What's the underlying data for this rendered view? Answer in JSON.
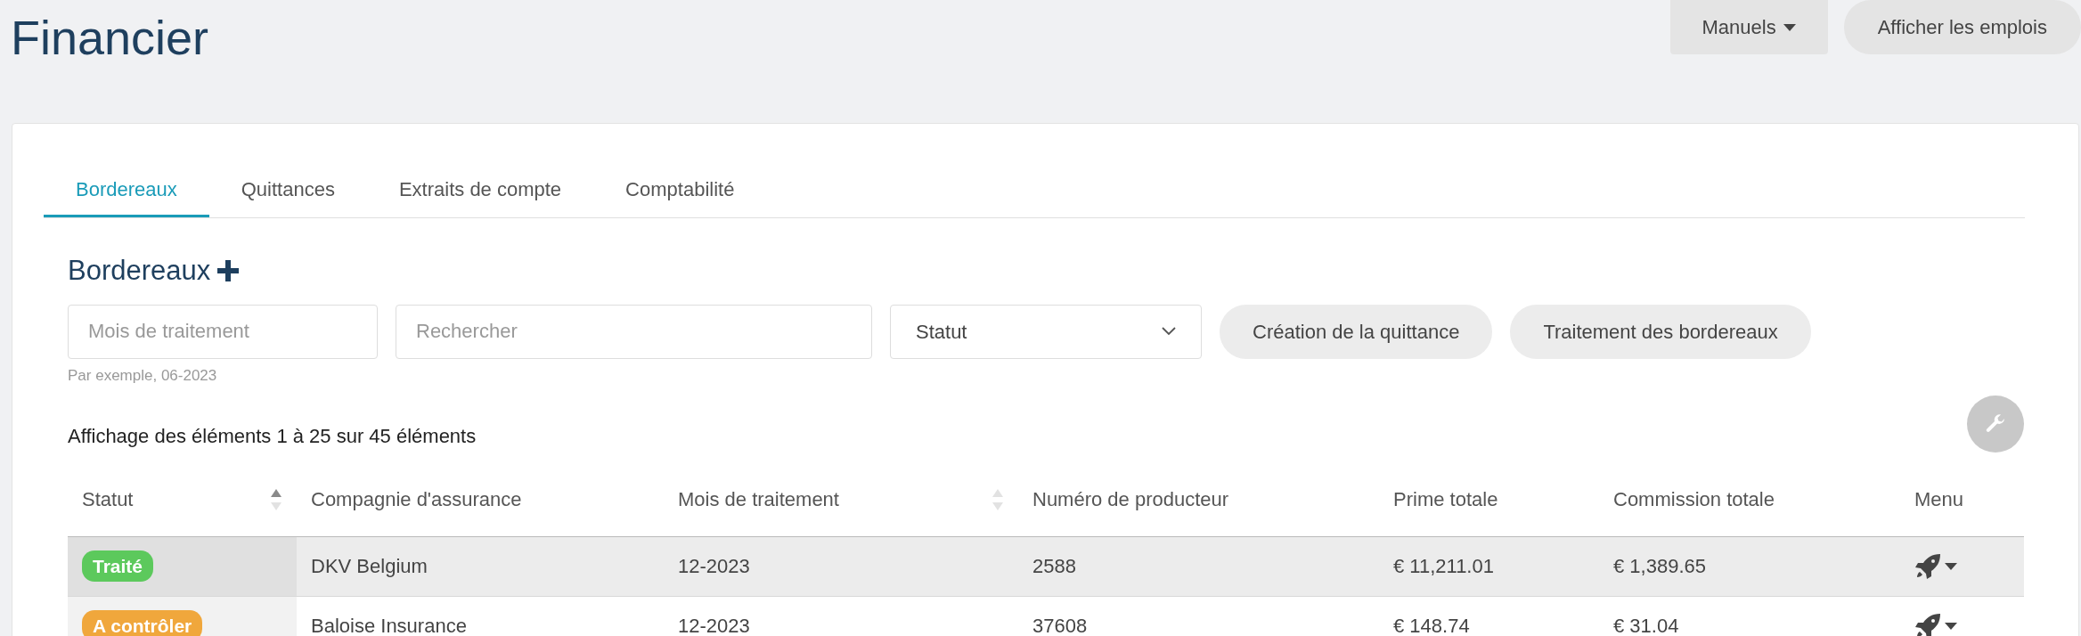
{
  "page_title": "Financier",
  "header_buttons": [
    {
      "label": "Manuels",
      "kind": "dropdown"
    },
    {
      "label": "Afficher les emplois",
      "kind": "pill"
    }
  ],
  "tabs": [
    {
      "label": "Bordereaux",
      "selected": true
    },
    {
      "label": "Quittances",
      "selected": false
    },
    {
      "label": "Extraits de compte",
      "selected": false
    },
    {
      "label": "Comptabilité",
      "selected": false
    }
  ],
  "section_title": "Bordereaux",
  "filters": {
    "month": {
      "placeholder": "Mois de traitement",
      "hint": "Par exemple, 06-2023"
    },
    "search": {
      "placeholder": "Rechercher"
    },
    "status": {
      "value": "Statut"
    }
  },
  "actions": [
    "Création de la quittance",
    "Traitement des bordereaux"
  ],
  "info": "Affichage des éléments 1 à 25 sur 45 éléments",
  "table": {
    "columns": [
      {
        "label": "Statut",
        "sortable": true,
        "sorted": true
      },
      {
        "label": "Compagnie d'assurance",
        "sortable": false,
        "sorted": false
      },
      {
        "label": "Mois de traitement",
        "sortable": true,
        "sorted": false
      },
      {
        "label": "Numéro de producteur",
        "sortable": false,
        "sorted": false
      },
      {
        "label": "Prime totale",
        "sortable": false,
        "sorted": false
      },
      {
        "label": "Commission totale",
        "sortable": false,
        "sorted": false
      },
      {
        "label": "Menu",
        "sortable": false,
        "sorted": false
      }
    ],
    "rows": [
      {
        "highlighted": true,
        "status": {
          "label": "Traité",
          "color": "#5cc95c"
        },
        "company": "DKV Belgium",
        "month": "12-2023",
        "producer": "2588",
        "premium": "€ 11,211.01",
        "commission": "€ 1,389.65"
      },
      {
        "highlighted": false,
        "status": {
          "label": "A contrôler",
          "color": "#f0a73c"
        },
        "company": "Baloise Insurance",
        "month": "12-2023",
        "producer": "37608",
        "premium": "€ 148.74",
        "commission": "€ 31.04"
      }
    ]
  }
}
